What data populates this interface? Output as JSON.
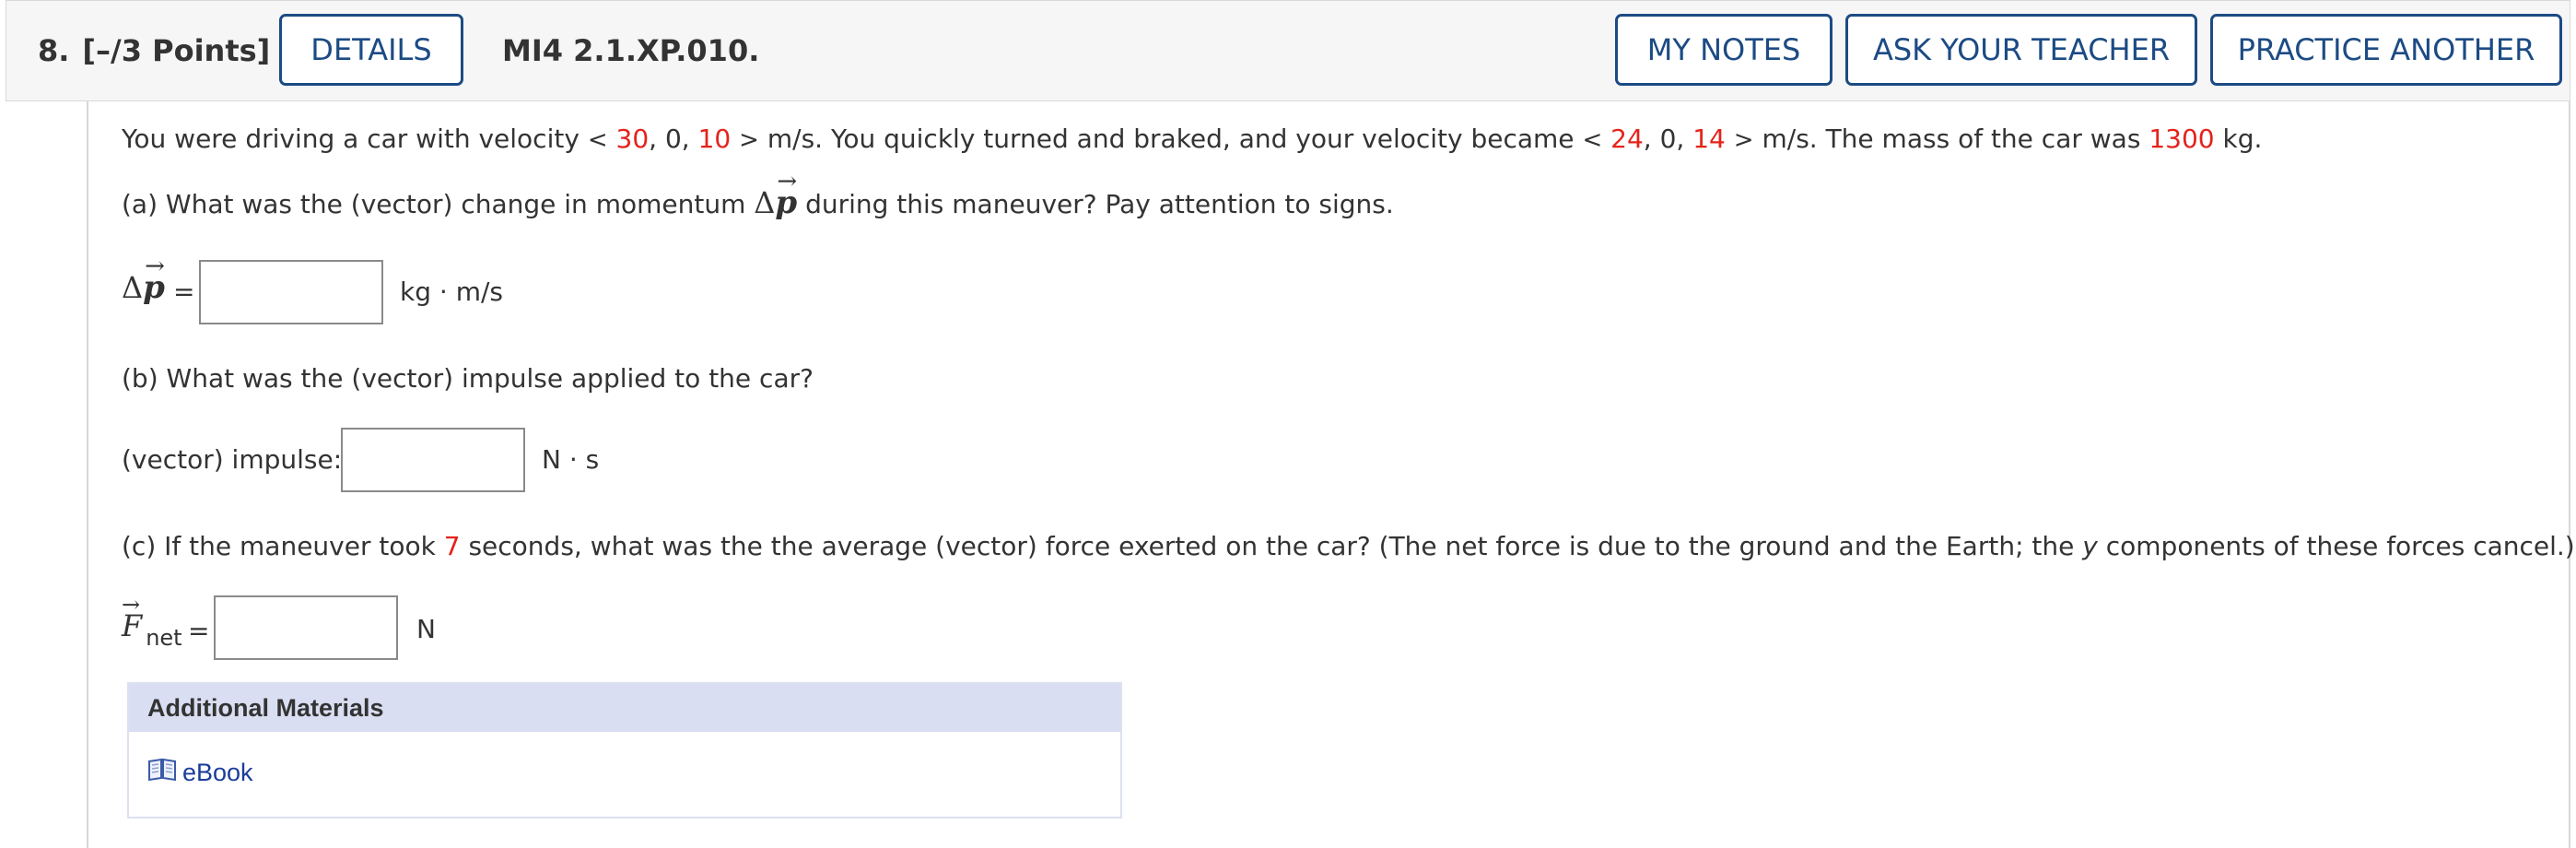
{
  "header": {
    "question_number": "8.",
    "points": "[–/3 Points]",
    "details_label": "DETAILS",
    "problem_code": "MI4 2.1.XP.010.",
    "my_notes_label": "MY NOTES",
    "ask_teacher_label": "ASK YOUR TEACHER",
    "practice_label": "PRACTICE ANOTHER"
  },
  "problem": {
    "intro_1": "You were driving a car with velocity",
    "v1": [
      "30",
      "10"
    ],
    "v1_mid": "0",
    "intro_2": "m/s. You quickly turned and braked, and your velocity became",
    "v2": [
      "24",
      "14"
    ],
    "v2_mid": "0",
    "intro_3": "m/s. The mass of the car was",
    "mass": "1300",
    "intro_4": "kg.",
    "part_a": {
      "q_1": "(a) What was the (vector) change in momentum",
      "q_2": "during this maneuver? Pay attention to signs.",
      "label_delta": "Δ",
      "label_symbol": "p",
      "equals": "=",
      "value": "",
      "unit": "kg · m/s"
    },
    "part_b": {
      "question": "(b) What was the (vector) impulse applied to the car?",
      "label": "(vector) impulse:",
      "value": "",
      "unit": "N · s"
    },
    "part_c": {
      "q_1": "(c) If the maneuver took",
      "time": "7",
      "q_2": "seconds, what was the the average (vector) force exerted on the car? (The net force is due to the ground and the Earth; the",
      "q_y": "y",
      "q_3": "components of these forces cancel.)",
      "label_symbol": "F",
      "label_sub": "net",
      "equals": "=",
      "value": "",
      "unit": "N"
    }
  },
  "additional_materials": {
    "title": "Additional Materials",
    "ebook_label": "eBook",
    "ebook_icon": "book-icon"
  },
  "colors": {
    "accent": "#1c4b84",
    "random_value": "#e4231b",
    "materials_header": "#d9def2"
  }
}
